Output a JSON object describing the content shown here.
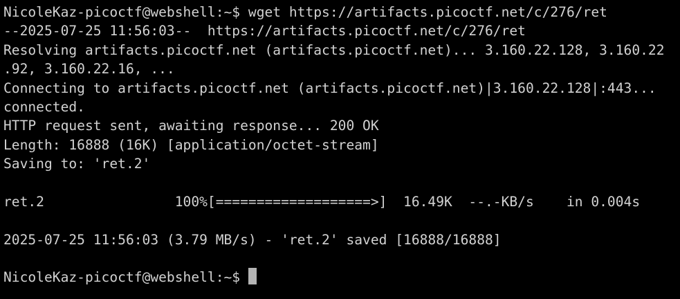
{
  "terminal": {
    "lines": [
      "NicoleKaz-picoctf@webshell:~$ wget https://artifacts.picoctf.net/c/276/ret",
      "--2025-07-25 11:56:03--  https://artifacts.picoctf.net/c/276/ret",
      "Resolving artifacts.picoctf.net (artifacts.picoctf.net)... 3.160.22.128, 3.160.22",
      ".92, 3.160.22.16, ...",
      "Connecting to artifacts.picoctf.net (artifacts.picoctf.net)|3.160.22.128|:443...",
      "connected.",
      "HTTP request sent, awaiting response... 200 OK",
      "Length: 16888 (16K) [application/octet-stream]",
      "Saving to: 'ret.2'",
      "",
      "ret.2                100%[===================>]  16.49K  --.-KB/s    in 0.004s",
      "",
      "2025-07-25 11:56:03 (3.79 MB/s) - 'ret.2' saved [16888/16888]",
      ""
    ],
    "prompt": "NicoleKaz-picoctf@webshell:~$ ",
    "colors": {
      "background": "#000000",
      "text": "#d2d2d2",
      "cursor": "#b4b4b4"
    }
  }
}
